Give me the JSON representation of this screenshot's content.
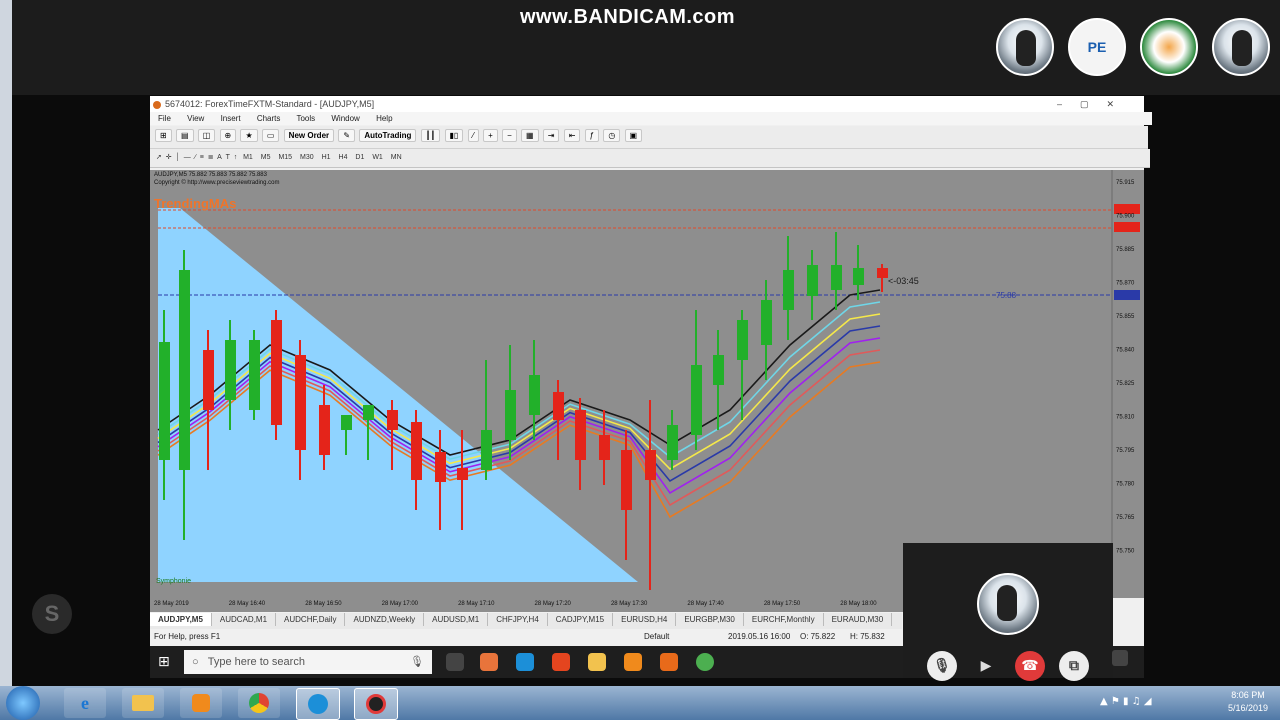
{
  "watermark": "www.BANDICAM.com",
  "participants": [
    {
      "name": "penguin-avatar"
    },
    {
      "initials": "PE"
    },
    {
      "name": "flag-avatar"
    },
    {
      "name": "penguin-avatar"
    }
  ],
  "mt4": {
    "title": "5674012: ForexTimeFXTM-Standard - [AUDJPY,M5]",
    "menu": [
      "File",
      "View",
      "Insert",
      "Charts",
      "Tools",
      "Window",
      "Help"
    ],
    "toolbar": {
      "new_order": "New Order",
      "auto_trading": "AutoTrading"
    },
    "timeframes": [
      "M1",
      "M5",
      "M15",
      "M30",
      "H1",
      "H4",
      "D1",
      "W1",
      "MN"
    ],
    "chart": {
      "symbol_line": "AUDJPY,M5  75.882 75.883 75.882 75.883",
      "copyright": "Copyright © http://www.preciseviewtrading.com",
      "indicator_name": "TrendingMAs",
      "countdown": "<-03:45",
      "bottom_label": "Symphonie",
      "price_ticks": [
        "75.915",
        "75.900",
        "75.885",
        "75.870",
        "75.855",
        "75.840",
        "75.825",
        "75.810",
        "75.795",
        "75.780",
        "75.765",
        "75.750"
      ],
      "time_ticks": [
        "28 May 2019",
        "28 May 16:40",
        "28 May 16:50",
        "28 May 17:00",
        "28 May 17:10",
        "28 May 17:20",
        "28 May 17:30",
        "28 May 17:40",
        "28 May 17:50",
        "28 May 18:00",
        "28 May 18:10",
        "28 May 18:20",
        "28 May 18:30"
      ],
      "hline_label": "75.88"
    },
    "tabs": [
      "AUDJPY,M5",
      "AUDCAD,M1",
      "AUDCHF,Daily",
      "AUDNZD,Weekly",
      "AUDUSD,M1",
      "CHFJPY,H4",
      "CADJPY,M15",
      "EURUSD,H4",
      "EURGBP,M30",
      "EURCHF,Monthly",
      "EURAUD,M30"
    ],
    "status": {
      "help": "For Help, press F1",
      "profile": "Default",
      "datetime": "2019.05.16 16:00",
      "open": "O: 75.822",
      "high": "H: 75.832"
    }
  },
  "win10": {
    "search_placeholder": "Type here to search"
  },
  "skype_buttons": [
    "mic-icon",
    "video-icon",
    "hangup-icon",
    "share-icon"
  ],
  "win7": {
    "time": "8:06 PM",
    "date": "5/16/2019"
  },
  "colors": {
    "bull": "#22b02a",
    "bear": "#e4241a",
    "chart_bg": "#8e8e8e",
    "triangle": "#8fd3ff"
  }
}
